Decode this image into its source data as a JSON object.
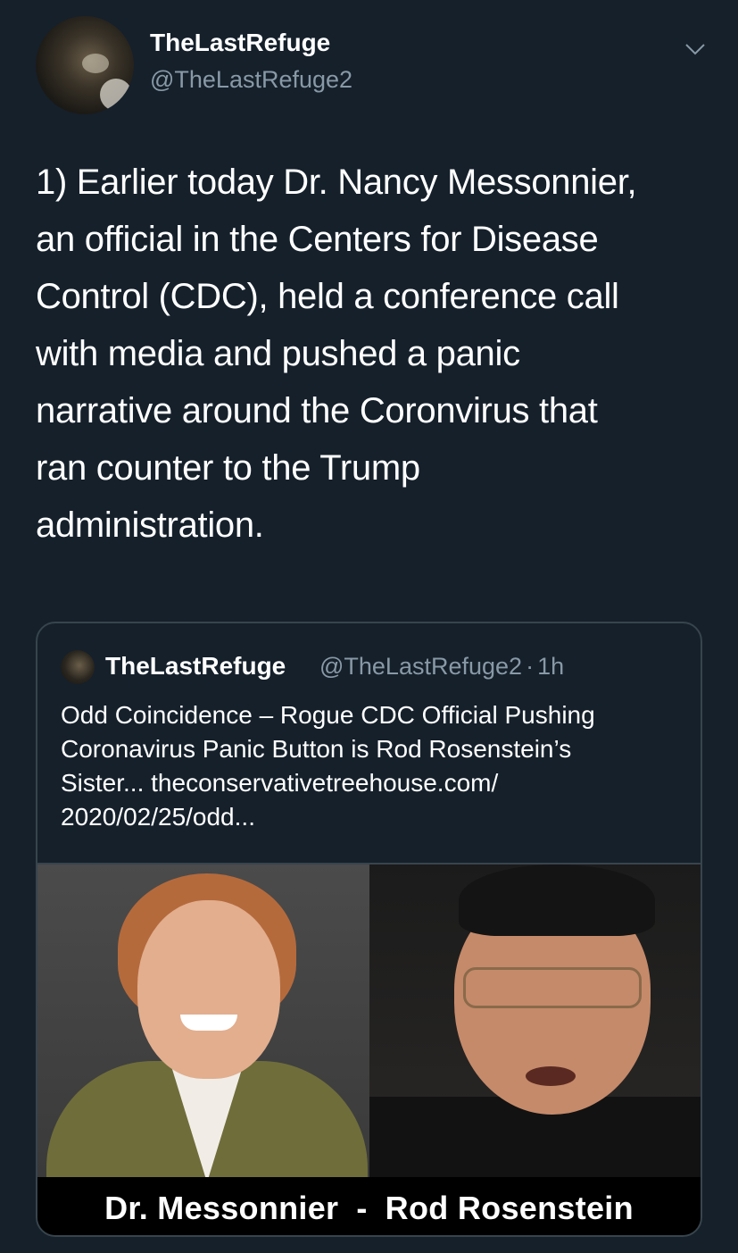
{
  "tweet": {
    "author": {
      "display_name": "TheLastRefuge",
      "handle": "@TheLastRefuge2"
    },
    "menu_icon": "chevron-down-icon",
    "text": "1) Earlier today Dr. Nancy Messonnier,\nan official in the Centers for Disease\nControl (CDC), held a conference call\nwith media and pushed a panic\nnarrative around the Coronvirus that\nran counter to the Trump\nadministration."
  },
  "quote": {
    "author": {
      "display_name": "TheLastRefuge",
      "handle": "@TheLastRefuge2",
      "separator": "·",
      "time": "1h"
    },
    "text": "Odd Coincidence – Rogue CDC Official Pushing\nCoronavirus Panic Button is Rod Rosenstein’s\nSister... theconservativetreehouse.com/\n2020/02/25/odd...",
    "image": {
      "left_caption": "Dr. Messonnier",
      "separator": "-",
      "right_caption": "Rod Rosenstein"
    }
  },
  "colors": {
    "background": "#15202b",
    "text": "#ffffff",
    "secondary": "#8899a6",
    "border": "#38444d"
  }
}
